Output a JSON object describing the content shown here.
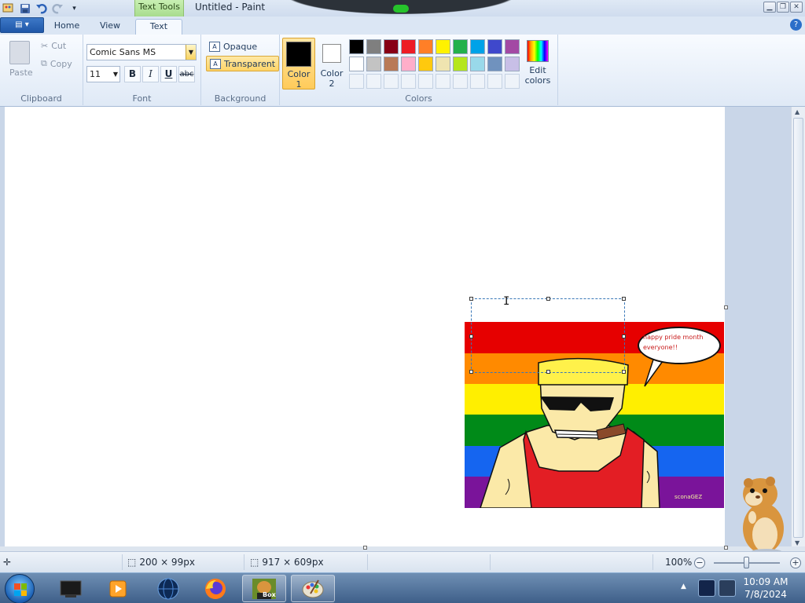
{
  "window": {
    "title": "Untitled - Paint",
    "context_tab_group": "Text Tools"
  },
  "tabs": [
    {
      "label": "Home"
    },
    {
      "label": "View"
    },
    {
      "label": "Text"
    }
  ],
  "ribbon": {
    "clipboard": {
      "group_label": "Clipboard",
      "paste": "Paste",
      "cut": "Cut",
      "copy": "Copy"
    },
    "font": {
      "group_label": "Font",
      "family": "Comic Sans MS",
      "size": "11",
      "bold": "B",
      "italic": "I",
      "underline": "U",
      "strikethrough": "abc"
    },
    "background": {
      "group_label": "Background",
      "opaque": "Opaque",
      "transparent": "Transparent",
      "selected": "transparent"
    },
    "colors": {
      "group_label": "Colors",
      "color1_label": "Color",
      "color1_num": "1",
      "color1_value": "#000000",
      "color2_label": "Color",
      "color2_num": "2",
      "color2_value": "#ffffff",
      "edit_label": "Edit",
      "edit_label2": "colors",
      "palette_row1": [
        "#000000",
        "#7f7f7f",
        "#880015",
        "#ed1c24",
        "#ff7f27",
        "#fff200",
        "#22b14c",
        "#00a2e8",
        "#3f48cc",
        "#a349a4"
      ],
      "palette_row2": [
        "#ffffff",
        "#c3c3c3",
        "#b97a57",
        "#ffaec9",
        "#ffc90e",
        "#efe4b0",
        "#b5e61d",
        "#99d9ea",
        "#7092be",
        "#c8bfe7"
      ]
    }
  },
  "canvas": {
    "speech_bubble_line1": "happy pride month",
    "speech_bubble_line2": "everyone!!",
    "signature": "sconaGEZ"
  },
  "statusbar": {
    "selection_size": "200 × 99px",
    "image_size": "917 × 609px",
    "zoom": "100%"
  },
  "taskbar": {
    "time": "10:09 AM",
    "date": "7/8/2024",
    "pinned_box_label": "Box"
  }
}
